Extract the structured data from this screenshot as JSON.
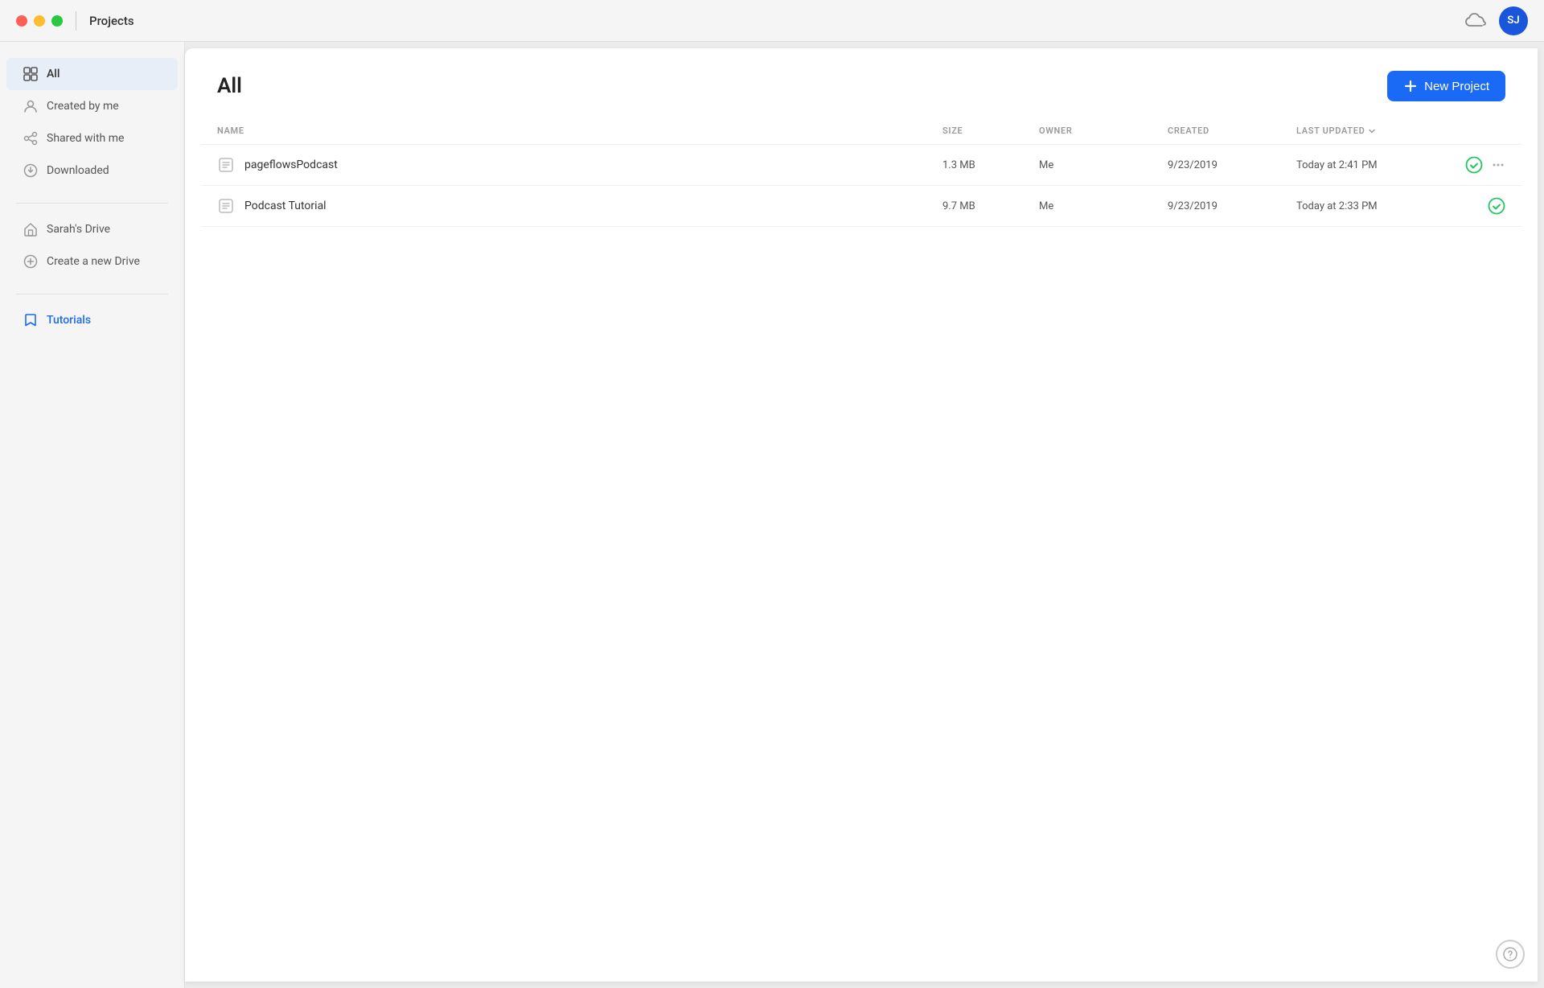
{
  "titlebar": {
    "title": "Projects",
    "avatar_initials": "SJ",
    "avatar_bg": "#1a56db"
  },
  "sidebar": {
    "nav_items": [
      {
        "id": "all",
        "label": "All",
        "active": true
      },
      {
        "id": "created-by-me",
        "label": "Created by me",
        "active": false
      },
      {
        "id": "shared-with-me",
        "label": "Shared with me",
        "active": false
      },
      {
        "id": "downloaded",
        "label": "Downloaded",
        "active": false
      }
    ],
    "drive_items": [
      {
        "id": "sarahs-drive",
        "label": "Sarah's Drive"
      }
    ],
    "create_drive_label": "Create a new Drive",
    "tutorials_label": "Tutorials"
  },
  "main": {
    "title": "All",
    "new_project_label": "+ New Project",
    "table": {
      "headers": {
        "name": "NAME",
        "size": "SIZE",
        "owner": "OWNER",
        "created": "CREATED",
        "last_updated": "LAST UPDATED"
      },
      "rows": [
        {
          "name": "pageflowsPodcast",
          "size": "1.3 MB",
          "owner": "Me",
          "created": "9/23/2019",
          "last_updated": "Today at 2:41 PM",
          "synced": true,
          "show_more": true
        },
        {
          "name": "Podcast Tutorial",
          "size": "9.7 MB",
          "owner": "Me",
          "created": "9/23/2019",
          "last_updated": "Today at 2:33 PM",
          "synced": true,
          "show_more": false
        }
      ]
    }
  },
  "colors": {
    "accent": "#1a6af5",
    "synced": "#22c55e",
    "tutorials": "#1a6af5"
  }
}
